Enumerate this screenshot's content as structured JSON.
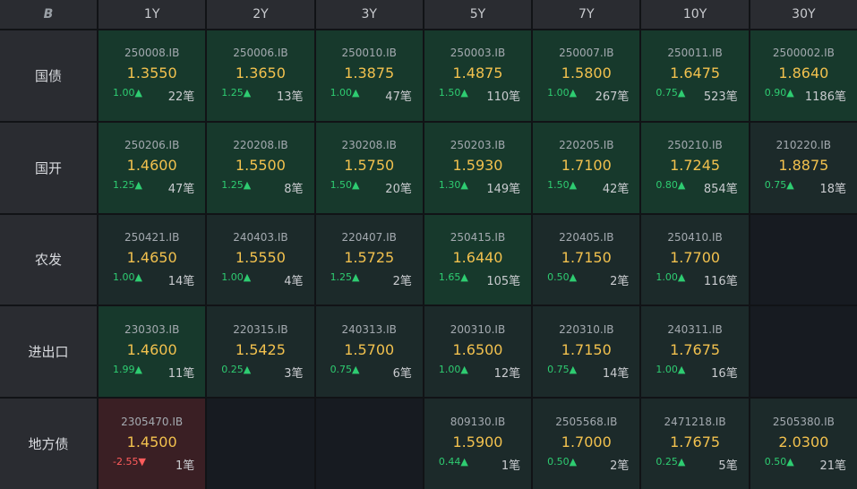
{
  "header": {
    "logo": "B",
    "tenors": [
      "1Y",
      "2Y",
      "3Y",
      "5Y",
      "7Y",
      "10Y",
      "30Y"
    ]
  },
  "rows": [
    {
      "label": "国债",
      "cells": [
        {
          "code": "250008.IB",
          "yield": "1.3550",
          "chg": "1.00▲",
          "cnt": "22笔",
          "dir": "up",
          "bg": "green"
        },
        {
          "code": "250006.IB",
          "yield": "1.3650",
          "chg": "1.25▲",
          "cnt": "13笔",
          "dir": "up",
          "bg": "green"
        },
        {
          "code": "250010.IB",
          "yield": "1.3875",
          "chg": "1.00▲",
          "cnt": "47笔",
          "dir": "up",
          "bg": "green"
        },
        {
          "code": "250003.IB",
          "yield": "1.4875",
          "chg": "1.50▲",
          "cnt": "110笔",
          "dir": "up",
          "bg": "green"
        },
        {
          "code": "250007.IB",
          "yield": "1.5800",
          "chg": "1.00▲",
          "cnt": "267笔",
          "dir": "up",
          "bg": "green"
        },
        {
          "code": "250011.IB",
          "yield": "1.6475",
          "chg": "0.75▲",
          "cnt": "523笔",
          "dir": "up",
          "bg": "green"
        },
        {
          "code": "2500002.IB",
          "yield": "1.8640",
          "chg": "0.90▲",
          "cnt": "1186笔",
          "dir": "up",
          "bg": "green"
        }
      ]
    },
    {
      "label": "国开",
      "cells": [
        {
          "code": "250206.IB",
          "yield": "1.4600",
          "chg": "1.25▲",
          "cnt": "47笔",
          "dir": "up",
          "bg": "green"
        },
        {
          "code": "220208.IB",
          "yield": "1.5500",
          "chg": "1.25▲",
          "cnt": "8笔",
          "dir": "up",
          "bg": "green"
        },
        {
          "code": "230208.IB",
          "yield": "1.5750",
          "chg": "1.50▲",
          "cnt": "20笔",
          "dir": "up",
          "bg": "green"
        },
        {
          "code": "250203.IB",
          "yield": "1.5930",
          "chg": "1.30▲",
          "cnt": "149笔",
          "dir": "up",
          "bg": "green"
        },
        {
          "code": "220205.IB",
          "yield": "1.7100",
          "chg": "1.50▲",
          "cnt": "42笔",
          "dir": "up",
          "bg": "green"
        },
        {
          "code": "250210.IB",
          "yield": "1.7245",
          "chg": "0.80▲",
          "cnt": "854笔",
          "dir": "up",
          "bg": "green"
        },
        {
          "code": "210220.IB",
          "yield": "1.8875",
          "chg": "0.75▲",
          "cnt": "18笔",
          "dir": "up",
          "bg": "dark"
        }
      ]
    },
    {
      "label": "农发",
      "cells": [
        {
          "code": "250421.IB",
          "yield": "1.4650",
          "chg": "1.00▲",
          "cnt": "14笔",
          "dir": "up",
          "bg": "dark"
        },
        {
          "code": "240403.IB",
          "yield": "1.5550",
          "chg": "1.00▲",
          "cnt": "4笔",
          "dir": "up",
          "bg": "dark"
        },
        {
          "code": "220407.IB",
          "yield": "1.5725",
          "chg": "1.25▲",
          "cnt": "2笔",
          "dir": "up",
          "bg": "dark"
        },
        {
          "code": "250415.IB",
          "yield": "1.6440",
          "chg": "1.65▲",
          "cnt": "105笔",
          "dir": "up",
          "bg": "green"
        },
        {
          "code": "220405.IB",
          "yield": "1.7150",
          "chg": "0.50▲",
          "cnt": "2笔",
          "dir": "up",
          "bg": "dark"
        },
        {
          "code": "250410.IB",
          "yield": "1.7700",
          "chg": "1.00▲",
          "cnt": "116笔",
          "dir": "up",
          "bg": "dark"
        },
        null
      ]
    },
    {
      "label": "进出口",
      "cells": [
        {
          "code": "230303.IB",
          "yield": "1.4600",
          "chg": "1.99▲",
          "cnt": "11笔",
          "dir": "up",
          "bg": "green"
        },
        {
          "code": "220315.IB",
          "yield": "1.5425",
          "chg": "0.25▲",
          "cnt": "3笔",
          "dir": "up",
          "bg": "dark"
        },
        {
          "code": "240313.IB",
          "yield": "1.5700",
          "chg": "0.75▲",
          "cnt": "6笔",
          "dir": "up",
          "bg": "dark"
        },
        {
          "code": "200310.IB",
          "yield": "1.6500",
          "chg": "1.00▲",
          "cnt": "12笔",
          "dir": "up",
          "bg": "dark"
        },
        {
          "code": "220310.IB",
          "yield": "1.7150",
          "chg": "0.75▲",
          "cnt": "14笔",
          "dir": "up",
          "bg": "dark"
        },
        {
          "code": "240311.IB",
          "yield": "1.7675",
          "chg": "1.00▲",
          "cnt": "16笔",
          "dir": "up",
          "bg": "dark"
        },
        null
      ]
    },
    {
      "label": "地方债",
      "cells": [
        {
          "code": "2305470.IB",
          "yield": "1.4500",
          "chg": "-2.55▼",
          "cnt": "1笔",
          "dir": "down",
          "bg": "red"
        },
        null,
        null,
        {
          "code": "809130.IB",
          "yield": "1.5900",
          "chg": "0.44▲",
          "cnt": "1笔",
          "dir": "up",
          "bg": "dark"
        },
        {
          "code": "2505568.IB",
          "yield": "1.7000",
          "chg": "0.50▲",
          "cnt": "2笔",
          "dir": "up",
          "bg": "dark"
        },
        {
          "code": "2471218.IB",
          "yield": "1.7675",
          "chg": "0.25▲",
          "cnt": "5笔",
          "dir": "up",
          "bg": "dark"
        },
        {
          "code": "2505380.IB",
          "yield": "2.0300",
          "chg": "0.50▲",
          "cnt": "21笔",
          "dir": "up",
          "bg": "dark"
        }
      ]
    }
  ]
}
